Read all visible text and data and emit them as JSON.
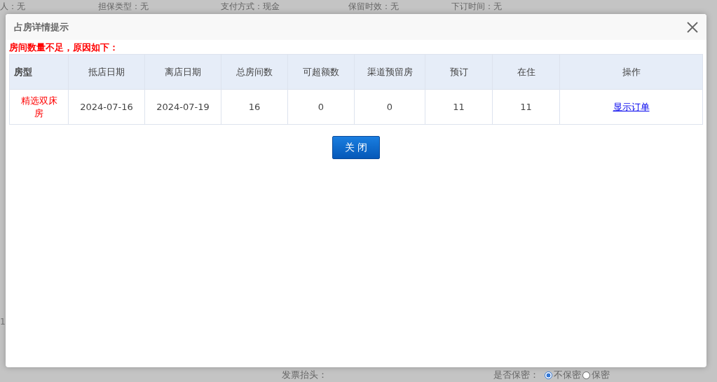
{
  "background": {
    "top_fields": [
      "人：无",
      "担保类型：无",
      "支付方式：现金",
      "保留时效：无",
      "下订时间：无"
    ],
    "side_fragments": [
      "1"
    ],
    "invoice_label": "发票抬头：",
    "secrecy_label": "是否保密：",
    "secrecy_options": [
      {
        "label": "不保密",
        "selected": true
      },
      {
        "label": "保密",
        "selected": false
      }
    ]
  },
  "dialog": {
    "title": "占房详情提示",
    "warning": "房间数量不足，原因如下：",
    "table": {
      "columns": [
        "房型",
        "抵店日期",
        "离店日期",
        "总房间数",
        "可超额数",
        "渠道预留房",
        "预订",
        "在住",
        "操作"
      ],
      "rows": [
        {
          "room_type": "精选双床房",
          "arrival": "2024-07-16",
          "departure": "2024-07-19",
          "total": "16",
          "overbook": "0",
          "reserved": "0",
          "booked": "11",
          "in_house": "11",
          "action": "显示订单"
        }
      ]
    },
    "button": "关 闭"
  }
}
